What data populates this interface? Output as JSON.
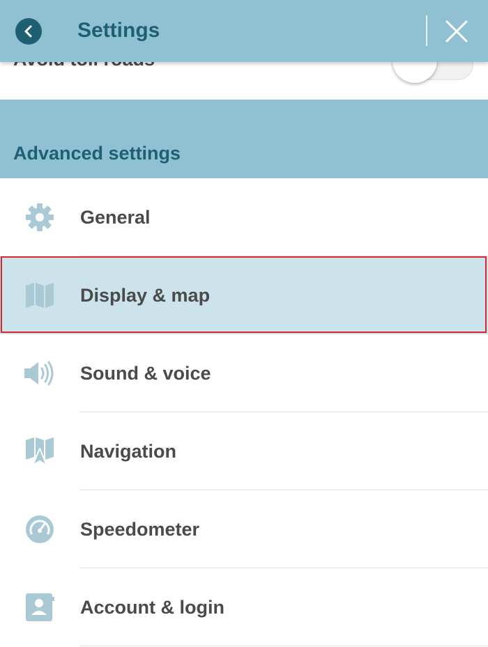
{
  "header": {
    "title": "Settings",
    "back_icon": "chevron-left-icon",
    "close_icon": "close-icon"
  },
  "route_options": {
    "avoid_toll_roads_label": "Avoid toll roads",
    "avoid_toll_roads_on": false
  },
  "advanced": {
    "section_title": "Advanced settings",
    "items": [
      {
        "label": "General",
        "icon": "gear-icon",
        "selected": false
      },
      {
        "label": "Display & map",
        "icon": "map-icon",
        "selected": true
      },
      {
        "label": "Sound & voice",
        "icon": "speaker-icon",
        "selected": false
      },
      {
        "label": "Navigation",
        "icon": "navigation-map-icon",
        "selected": false
      },
      {
        "label": "Speedometer",
        "icon": "speedometer-icon",
        "selected": false
      },
      {
        "label": "Account & login",
        "icon": "account-icon",
        "selected": false
      }
    ]
  },
  "colors": {
    "header_bg": "#8fc1d2",
    "header_text": "#1e5f74",
    "selected_bg": "#cde3ec",
    "highlight_border": "#d9232d",
    "icon_color": "#a9c9d5"
  }
}
